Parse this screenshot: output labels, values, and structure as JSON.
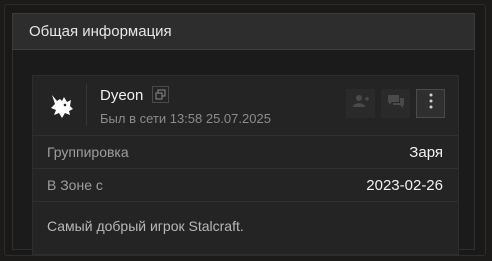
{
  "panel": {
    "title": "Общая информация"
  },
  "profile": {
    "username": "Dyeon",
    "last_seen": "Был в сети 13:58 25.07.2025"
  },
  "info": [
    {
      "label": "Группировка",
      "value": "Заря"
    },
    {
      "label": "В Зоне с",
      "value": "2023-02-26"
    }
  ],
  "status": "Самый добрый игрок Stalcraft.",
  "icons": {
    "avatar": "wolf-head-icon",
    "copy": "copy-icon",
    "add_friend": "add-friend-icon",
    "message": "message-icon",
    "more": "more-vertical-icon"
  },
  "colors": {
    "background": "#1d1b19",
    "header": "#2d2d2d",
    "card": "#242424",
    "text_primary": "#f0f0f0",
    "text_secondary": "#8c8c8c"
  }
}
